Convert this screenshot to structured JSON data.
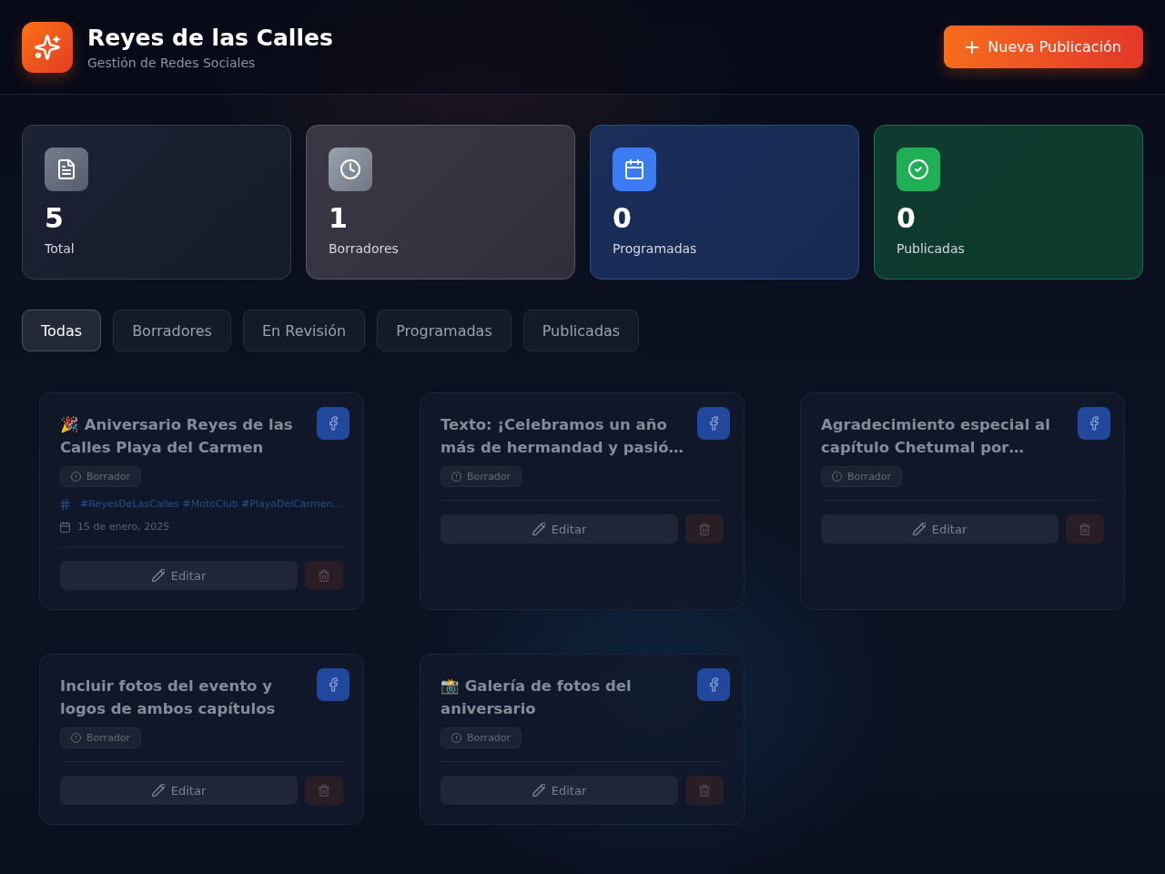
{
  "header": {
    "title": "Reyes de las Calles",
    "subtitle": "Gestión de Redes Sociales",
    "new_button": "Nueva Publicación"
  },
  "stats": [
    {
      "kind": "total",
      "value": "5",
      "label": "Total"
    },
    {
      "kind": "draft",
      "value": "1",
      "label": "Borradores"
    },
    {
      "kind": "scheduled",
      "value": "0",
      "label": "Programadas"
    },
    {
      "kind": "published",
      "value": "0",
      "label": "Publicadas"
    }
  ],
  "filter_tabs": [
    {
      "label": "Todas",
      "selected": true
    },
    {
      "label": "Borradores",
      "selected": false
    },
    {
      "label": "En Revisión",
      "selected": false
    },
    {
      "label": "Programadas",
      "selected": false
    },
    {
      "label": "Publicadas",
      "selected": false
    }
  ],
  "posts": [
    {
      "title": "🎉 Aniversario Reyes de las Calles Playa del Carmen",
      "status": "Borrador",
      "hashtags": "#ReyesDeLasCalles #MotoClub #PlayaDelCarmen…",
      "date": "15 de enero, 2025",
      "edit_label": "Editar"
    },
    {
      "title": "Texto: ¡Celebramos un año más de hermandad y pasió…",
      "status": "Borrador",
      "edit_label": "Editar"
    },
    {
      "title": "Agradecimiento especial al capítulo Chetumal por…",
      "status": "Borrador",
      "edit_label": "Editar"
    },
    {
      "title": "Incluir fotos del evento y logos de ambos capítulos",
      "status": "Borrador",
      "edit_label": "Editar"
    },
    {
      "title": "📸 Galería de fotos del aniversario",
      "status": "Borrador",
      "edit_label": "Editar"
    }
  ]
}
